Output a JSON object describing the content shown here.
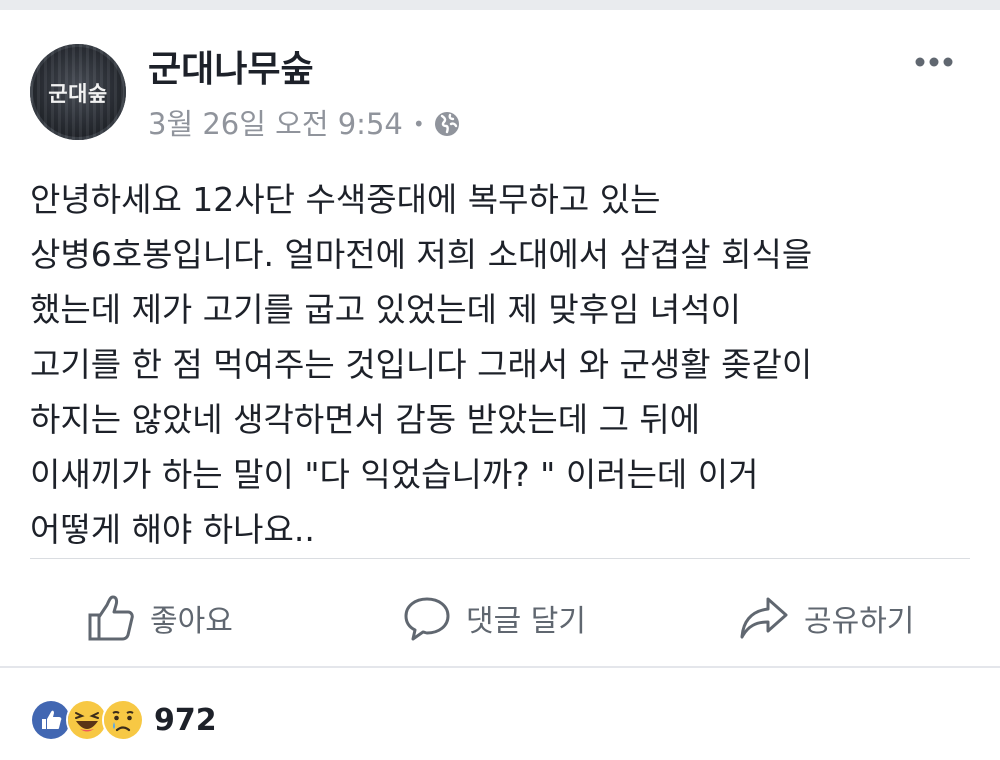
{
  "post": {
    "page_name": "군대나무숲",
    "avatar_text": "군대숲",
    "timestamp": "3월 26일 오전 9:54",
    "separator": "•",
    "privacy_icon": "globe-icon",
    "body_lines": [
      "안녕하세요 12사단 수색중대에 복무하고 있는",
      "상병6호봉입니다. 얼마전에 저희 소대에서 삼겹살 회식을",
      "했는데 제가 고기를 굽고 있었는데 제 맞후임 녀석이",
      "고기를 한 점 먹여주는 것입니다 그래서 와 군생활 좆같이",
      "하지는 않았네 생각하면서 감동 받았는데 그 뒤에",
      "이새끼가 하는 말이 \"다 익었습니까? \" 이러는데 이거",
      "어떻게 해야 하나요.."
    ]
  },
  "actions": {
    "like_label": "좋아요",
    "comment_label": "댓글 달기",
    "share_label": "공유하기"
  },
  "reactions": {
    "icons": [
      "like-icon",
      "haha-icon",
      "sad-icon"
    ],
    "count": "972"
  },
  "colors": {
    "like_blue": "#4267b2",
    "emoji_yellow": "#f7c844",
    "meta_gray": "#90949c",
    "text": "#1d2129"
  }
}
